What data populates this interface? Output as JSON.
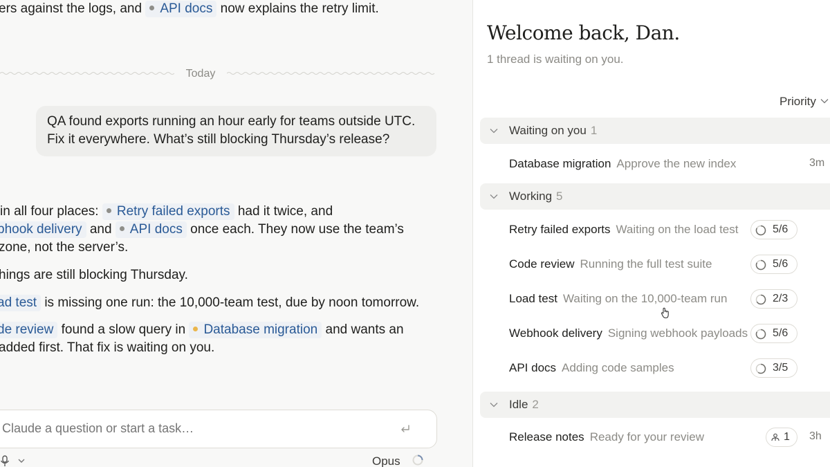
{
  "chat": {
    "top_line": {
      "before": "ers against the logs, and",
      "chip": "API docs",
      "after": "now explains the retry limit."
    },
    "divider_label": "Today",
    "user_message": {
      "line1": "QA found exports running an hour early for teams outside UTC.",
      "line2": "Fix it everywhere. What’s still blocking Thursday’s release?"
    },
    "reply": {
      "l1_before": "in all four places:",
      "l1_chip": "Retry failed exports",
      "l1_after": "had it twice, and",
      "l2_chip": "bhook delivery",
      "l2_mid": "and",
      "l2_chip2": "API docs",
      "l2_after": "once each. They now use the team’s",
      "l3": "zone, not the server’s.",
      "l4": "hings are still blocking Thursday.",
      "l5_chip": "ad test",
      "l5_after": "is missing one run: the 10,000-team test, due by noon tomorrow.",
      "l6_chip": "de review",
      "l6_mid": "found a slow query in",
      "l6_chip2": "Database migration",
      "l6_after": "and wants an",
      "l7": "added first. That fix is waiting on you."
    },
    "composer": {
      "placeholder": "Claude a question or start a task…",
      "model": "Opus",
      "icons": [
        "mic-icon",
        "chevron-down-icon",
        "enter-icon",
        "spinner-icon"
      ]
    },
    "colors": {
      "chip_bg": "#eef1f5",
      "chip_text": "#2a5a96",
      "amber": "#eab64c"
    }
  },
  "panel": {
    "welcome": "Welcome back, Dan.",
    "subtitle": "1 thread is waiting on you.",
    "sort_label": "Priority",
    "groups": [
      {
        "title": "Waiting on you",
        "count": "1",
        "rows": [
          {
            "name": "Database migration",
            "status": "Approve the new index",
            "time": "3m"
          }
        ]
      },
      {
        "title": "Working",
        "count": "5",
        "rows": [
          {
            "name": "Retry failed exports",
            "status": "Waiting on the load test",
            "progress": "5/6"
          },
          {
            "name": "Code review",
            "status": "Running the full test suite",
            "progress": "5/6"
          },
          {
            "name": "Load test",
            "status": "Waiting on the 10,000-team run",
            "progress": "2/3"
          },
          {
            "name": "Webhook delivery",
            "status": "Signing webhook payloads",
            "progress": "5/6"
          },
          {
            "name": "API docs",
            "status": "Adding code samples",
            "progress": "3/5"
          }
        ]
      },
      {
        "title": "Idle",
        "count": "2",
        "rows": [
          {
            "name": "Release notes",
            "status": "Ready for your review",
            "badge": "1",
            "time": "3h"
          }
        ]
      }
    ]
  }
}
